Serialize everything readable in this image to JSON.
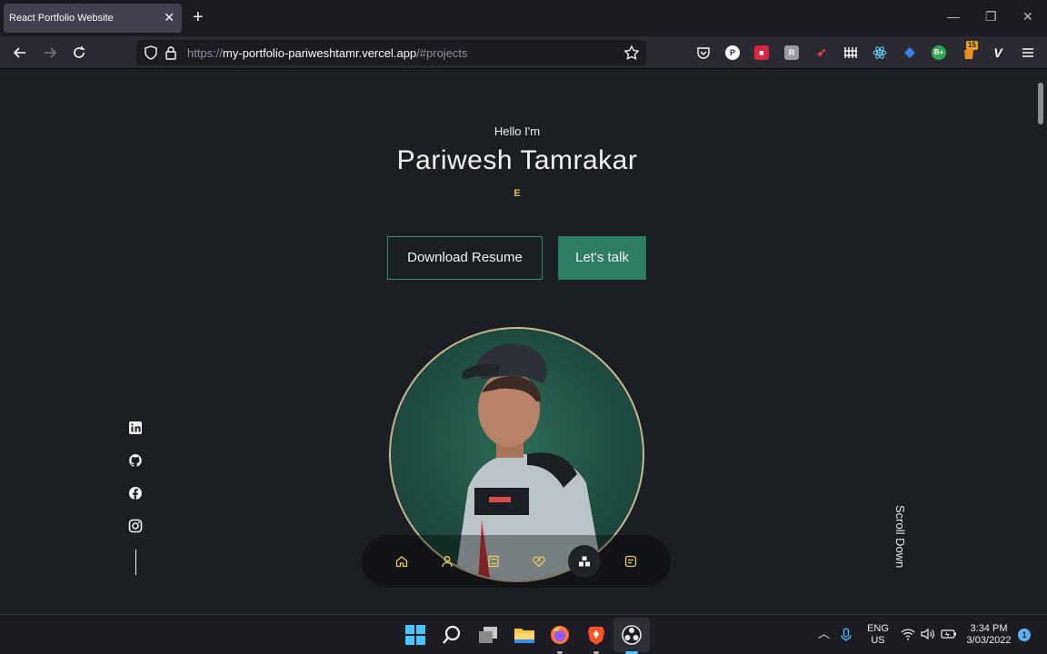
{
  "browser": {
    "tab_title": "React Portfolio Website",
    "tab_close": "✕",
    "new_tab": "+",
    "url_prefix": "https://",
    "url_host": "my-portfolio-pariweshtamr.vercel.app",
    "url_path": "/#projects",
    "extension_badge": "15"
  },
  "hero": {
    "greeting": "Hello I'm",
    "name": "Pariwesh Tamrakar",
    "typed_text": "E",
    "download_button": "Download Resume",
    "talk_button": "Let's talk",
    "scroll_down": "Scroll Down"
  },
  "colors": {
    "accent": "#2d7d64",
    "nav_icon": "#e8cf5c",
    "typed": "#d7c34a",
    "avatar_border": "#c8b48e"
  },
  "social_icons": [
    "linkedin-icon",
    "github-icon",
    "facebook-icon",
    "instagram-icon"
  ],
  "dock_icons": [
    "home-icon",
    "about-icon",
    "experience-icon",
    "services-icon",
    "portfolio-icon",
    "contact-icon"
  ],
  "dock_active": "portfolio-icon",
  "taskbar": {
    "lang_line1": "ENG",
    "lang_line2": "US",
    "time": "3:34 PM",
    "date": "3/03/2022",
    "notifications": "1"
  }
}
